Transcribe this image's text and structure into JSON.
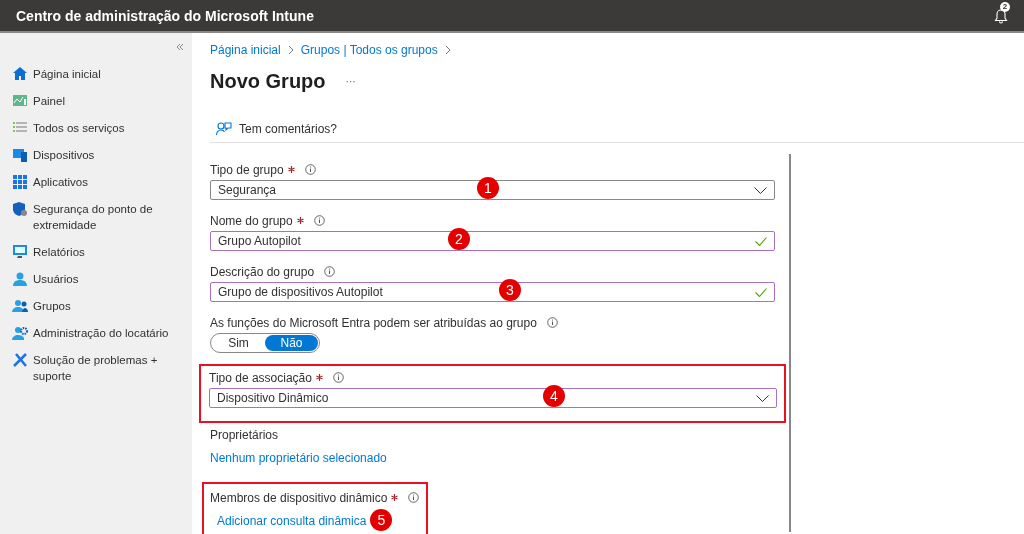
{
  "top_bar": {
    "title": "Centro de administração do Microsoft Intune",
    "notifications": "2"
  },
  "sidebar": {
    "items": [
      {
        "label": "Página inicial",
        "selected": false
      },
      {
        "label": "Painel",
        "selected": false
      },
      {
        "label": "Todos os serviços",
        "selected": false
      },
      {
        "label": "Dispositivos",
        "selected": false
      },
      {
        "label": "Aplicativos",
        "selected": false
      },
      {
        "label": "Segurança do ponto de extremidade",
        "selected": false
      },
      {
        "label": "Relatórios",
        "selected": false
      },
      {
        "label": "Usuários",
        "selected": false
      },
      {
        "label": "Grupos",
        "selected": false
      },
      {
        "label": "Administração do locatário",
        "selected": false
      },
      {
        "label": "Solução de problemas + suporte",
        "selected": false
      }
    ]
  },
  "breadcrumb": [
    "Página inicial",
    "Grupos | Todos os grupos"
  ],
  "page": {
    "title": "Novo Grupo",
    "more": "···"
  },
  "feedback": "Tem comentários?",
  "fields": [
    {
      "kind": "select",
      "label": "Tipo de grupo",
      "required": true,
      "info": true,
      "value": "Segurança",
      "modified": false,
      "marker": "1"
    },
    {
      "kind": "text",
      "label": "Nome do grupo",
      "required": true,
      "info": true,
      "value": "Grupo Autopilot",
      "modified": true,
      "valid": true,
      "marker": "2"
    },
    {
      "kind": "text",
      "label": "Descrição do grupo",
      "info": true,
      "value": "Grupo de dispositivos Autopilot",
      "modified": true,
      "valid": true,
      "marker": "3"
    },
    {
      "kind": "toggle",
      "label": "As funções do Microsoft Entra podem ser atribuídas ao grupo",
      "info": true,
      "options": [
        {
          "label": "Sim",
          "selected": false
        },
        {
          "label": "Não",
          "selected": true
        }
      ]
    },
    {
      "kind": "select",
      "label": "Tipo de associação",
      "required": true,
      "info": true,
      "value": "Dispositivo Dinâmico",
      "modified": true,
      "marker": "4",
      "highlighted": true
    },
    {
      "kind": "link",
      "label": "Proprietários",
      "link": "Nenhum proprietário selecionado"
    },
    {
      "kind": "link",
      "label": "Membros de dispositivo dinâmico",
      "required": true,
      "info": true,
      "link": "Adicionar consulta dinâmica",
      "marker": "5",
      "highlighted": true
    }
  ]
}
